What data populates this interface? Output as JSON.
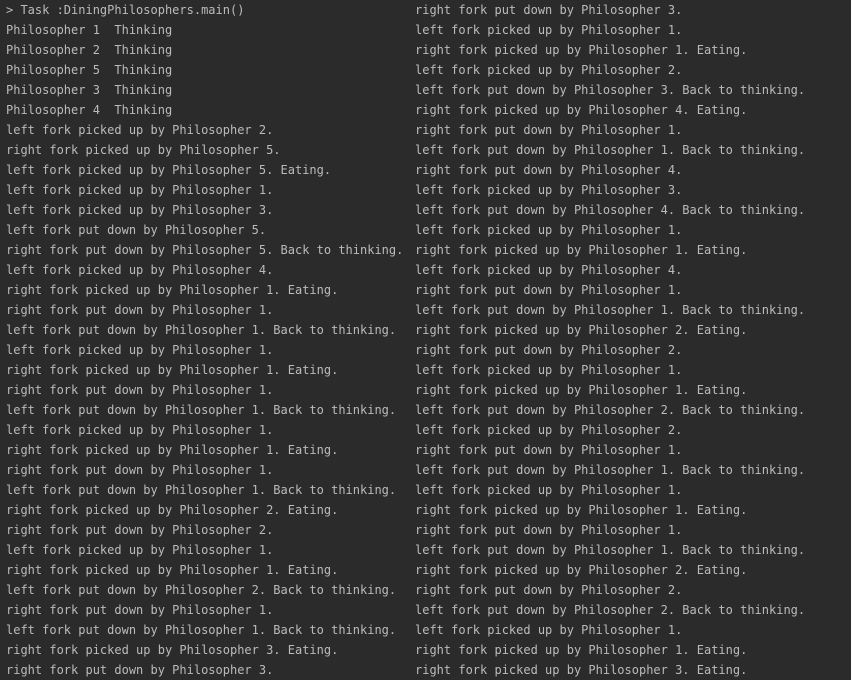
{
  "console": {
    "left_lines": [
      "> Task :DiningPhilosophers.main()",
      "Philosopher 1  Thinking",
      "Philosopher 2  Thinking",
      "Philosopher 5  Thinking",
      "Philosopher 3  Thinking",
      "Philosopher 4  Thinking",
      "left fork picked up by Philosopher 2.",
      "right fork picked up by Philosopher 5.",
      "left fork picked up by Philosopher 5. Eating.",
      "left fork picked up by Philosopher 1.",
      "left fork picked up by Philosopher 3.",
      "left fork put down by Philosopher 5.",
      "right fork put down by Philosopher 5. Back to thinking.",
      "left fork picked up by Philosopher 4.",
      "right fork picked up by Philosopher 1. Eating.",
      "right fork put down by Philosopher 1.",
      "left fork put down by Philosopher 1. Back to thinking.",
      "left fork picked up by Philosopher 1.",
      "right fork picked up by Philosopher 1. Eating.",
      "right fork put down by Philosopher 1.",
      "left fork put down by Philosopher 1. Back to thinking.",
      "left fork picked up by Philosopher 1.",
      "right fork picked up by Philosopher 1. Eating.",
      "right fork put down by Philosopher 1.",
      "left fork put down by Philosopher 1. Back to thinking.",
      "right fork picked up by Philosopher 2. Eating.",
      "right fork put down by Philosopher 2.",
      "left fork picked up by Philosopher 1.",
      "right fork picked up by Philosopher 1. Eating.",
      "left fork put down by Philosopher 2. Back to thinking.",
      "right fork put down by Philosopher 1.",
      "left fork put down by Philosopher 1. Back to thinking.",
      "right fork picked up by Philosopher 3. Eating.",
      "right fork put down by Philosopher 3."
    ],
    "right_lines": [
      "right fork put down by Philosopher 3.",
      "left fork picked up by Philosopher 1.",
      "right fork picked up by Philosopher 1. Eating.",
      "left fork picked up by Philosopher 2.",
      "left fork put down by Philosopher 3. Back to thinking.",
      "right fork picked up by Philosopher 4. Eating.",
      "right fork put down by Philosopher 1.",
      "left fork put down by Philosopher 1. Back to thinking.",
      "right fork put down by Philosopher 4.",
      "left fork picked up by Philosopher 3.",
      "left fork put down by Philosopher 4. Back to thinking.",
      "left fork picked up by Philosopher 1.",
      "right fork picked up by Philosopher 1. Eating.",
      "left fork picked up by Philosopher 4.",
      "right fork put down by Philosopher 1.",
      "left fork put down by Philosopher 1. Back to thinking.",
      "right fork picked up by Philosopher 2. Eating.",
      "right fork put down by Philosopher 2.",
      "left fork picked up by Philosopher 1.",
      "right fork picked up by Philosopher 1. Eating.",
      "left fork put down by Philosopher 2. Back to thinking.",
      "left fork picked up by Philosopher 2.",
      "right fork put down by Philosopher 1.",
      "left fork put down by Philosopher 1. Back to thinking.",
      "left fork picked up by Philosopher 1.",
      "right fork picked up by Philosopher 1. Eating.",
      "right fork put down by Philosopher 1.",
      "left fork put down by Philosopher 1. Back to thinking.",
      "right fork picked up by Philosopher 2. Eating.",
      "right fork put down by Philosopher 2.",
      "left fork put down by Philosopher 2. Back to thinking.",
      "left fork picked up by Philosopher 1.",
      "right fork picked up by Philosopher 1. Eating.",
      "right fork picked up by Philosopher 3. Eating."
    ]
  },
  "colors": {
    "background": "#2b2b2b",
    "text": "#bbbbbb"
  }
}
